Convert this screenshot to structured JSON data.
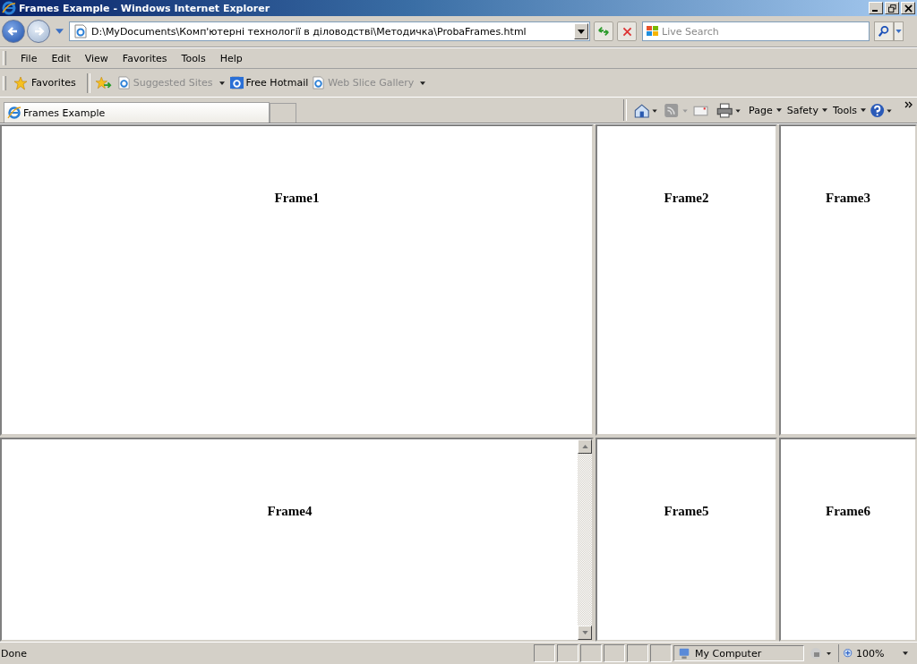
{
  "window": {
    "title": "Frames Example - Windows Internet Explorer"
  },
  "address_bar": {
    "value": "D:\\MyDocuments\\Комп'ютерні технології в діловодстві\\Методичка\\ProbaFrames.html"
  },
  "search": {
    "placeholder": "Live Search"
  },
  "menu": [
    "File",
    "Edit",
    "View",
    "Favorites",
    "Tools",
    "Help"
  ],
  "favorites_bar": {
    "label": "Favorites",
    "links": [
      {
        "label": "Suggested Sites",
        "disabled": true,
        "dropdown": true
      },
      {
        "label": "Free Hotmail",
        "disabled": false,
        "dropdown": false
      },
      {
        "label": "Web Slice Gallery",
        "disabled": true,
        "dropdown": true
      }
    ]
  },
  "tabs": [
    {
      "label": "Frames Example",
      "selected": true
    }
  ],
  "command_bar": [
    "Page",
    "Safety",
    "Tools"
  ],
  "frames": [
    {
      "heading": "Frame1",
      "scrollbar": false
    },
    {
      "heading": "Frame2",
      "scrollbar": false
    },
    {
      "heading": "Frame3",
      "scrollbar": false
    },
    {
      "heading": "Frame4",
      "scrollbar": true
    },
    {
      "heading": "Frame5",
      "scrollbar": false
    },
    {
      "heading": "Frame6",
      "scrollbar": false
    }
  ],
  "status_bar": {
    "text": "Done",
    "zone": "My Computer",
    "zoom": "100%"
  }
}
